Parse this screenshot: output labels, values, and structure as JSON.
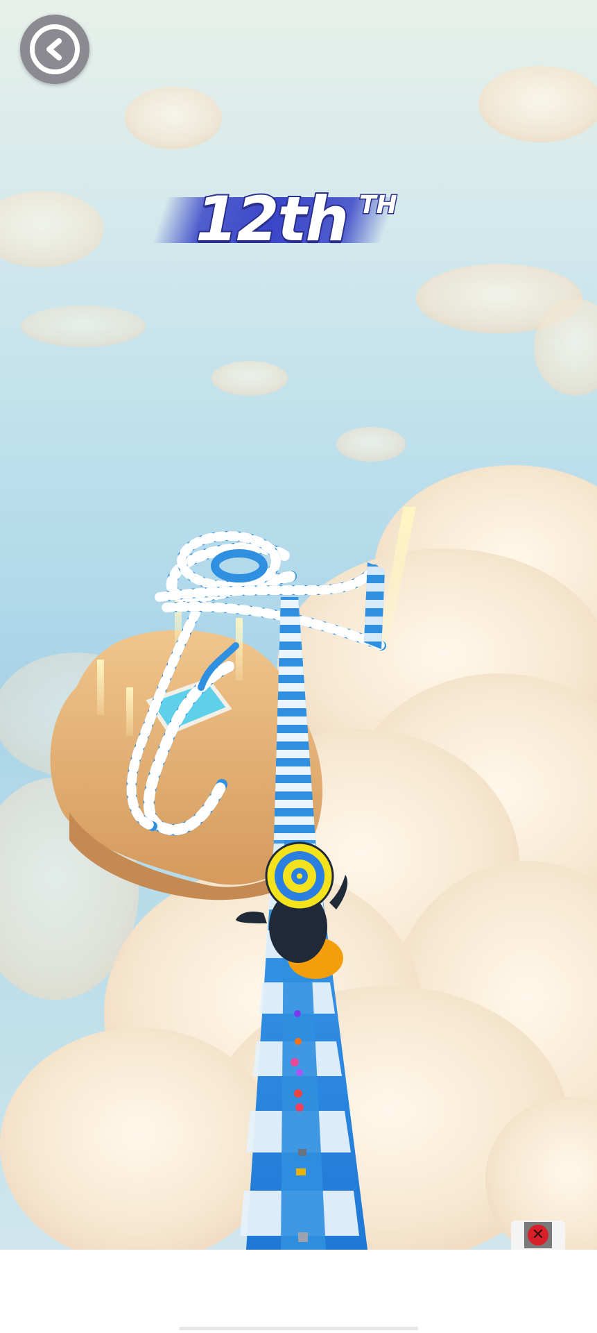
{
  "hud": {
    "rank_value": "12th",
    "rank_suffix": "TH",
    "back_icon": "chevron-left-icon"
  },
  "ad": {
    "close_icon": "close-icon"
  },
  "colors": {
    "rank_fill": "#ffffff",
    "rank_outline": "#2a2f8c",
    "rank_banner": "#3a46c8",
    "slide_blue": "#2f8fe0",
    "slide_white": "#ffffff",
    "island_sand": "#e6b57a",
    "player_ring_yellow": "#f3e21c",
    "player_ring_blue": "#2a7fe0"
  }
}
